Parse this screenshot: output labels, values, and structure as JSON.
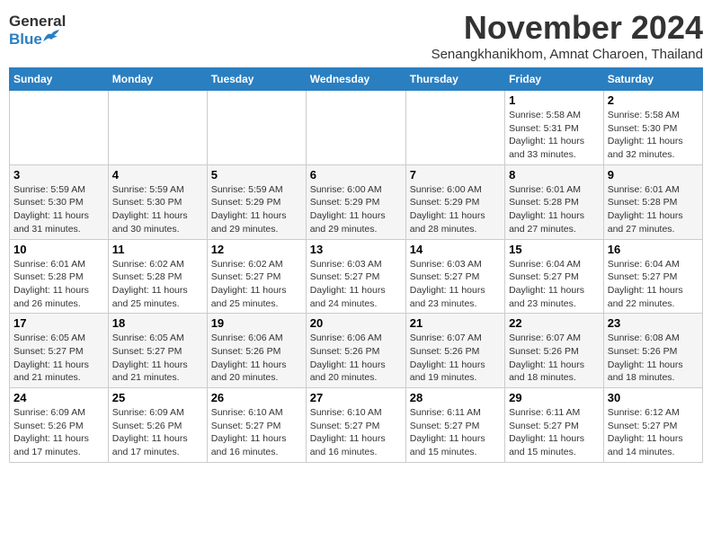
{
  "logo": {
    "line1": "General",
    "line2": "Blue"
  },
  "title": "November 2024",
  "subtitle": "Senangkhanikhom, Amnat Charoen, Thailand",
  "weekdays": [
    "Sunday",
    "Monday",
    "Tuesday",
    "Wednesday",
    "Thursday",
    "Friday",
    "Saturday"
  ],
  "weeks": [
    [
      {
        "day": "",
        "info": ""
      },
      {
        "day": "",
        "info": ""
      },
      {
        "day": "",
        "info": ""
      },
      {
        "day": "",
        "info": ""
      },
      {
        "day": "",
        "info": ""
      },
      {
        "day": "1",
        "info": "Sunrise: 5:58 AM\nSunset: 5:31 PM\nDaylight: 11 hours and 33 minutes."
      },
      {
        "day": "2",
        "info": "Sunrise: 5:58 AM\nSunset: 5:30 PM\nDaylight: 11 hours and 32 minutes."
      }
    ],
    [
      {
        "day": "3",
        "info": "Sunrise: 5:59 AM\nSunset: 5:30 PM\nDaylight: 11 hours and 31 minutes."
      },
      {
        "day": "4",
        "info": "Sunrise: 5:59 AM\nSunset: 5:30 PM\nDaylight: 11 hours and 30 minutes."
      },
      {
        "day": "5",
        "info": "Sunrise: 5:59 AM\nSunset: 5:29 PM\nDaylight: 11 hours and 29 minutes."
      },
      {
        "day": "6",
        "info": "Sunrise: 6:00 AM\nSunset: 5:29 PM\nDaylight: 11 hours and 29 minutes."
      },
      {
        "day": "7",
        "info": "Sunrise: 6:00 AM\nSunset: 5:29 PM\nDaylight: 11 hours and 28 minutes."
      },
      {
        "day": "8",
        "info": "Sunrise: 6:01 AM\nSunset: 5:28 PM\nDaylight: 11 hours and 27 minutes."
      },
      {
        "day": "9",
        "info": "Sunrise: 6:01 AM\nSunset: 5:28 PM\nDaylight: 11 hours and 27 minutes."
      }
    ],
    [
      {
        "day": "10",
        "info": "Sunrise: 6:01 AM\nSunset: 5:28 PM\nDaylight: 11 hours and 26 minutes."
      },
      {
        "day": "11",
        "info": "Sunrise: 6:02 AM\nSunset: 5:28 PM\nDaylight: 11 hours and 25 minutes."
      },
      {
        "day": "12",
        "info": "Sunrise: 6:02 AM\nSunset: 5:27 PM\nDaylight: 11 hours and 25 minutes."
      },
      {
        "day": "13",
        "info": "Sunrise: 6:03 AM\nSunset: 5:27 PM\nDaylight: 11 hours and 24 minutes."
      },
      {
        "day": "14",
        "info": "Sunrise: 6:03 AM\nSunset: 5:27 PM\nDaylight: 11 hours and 23 minutes."
      },
      {
        "day": "15",
        "info": "Sunrise: 6:04 AM\nSunset: 5:27 PM\nDaylight: 11 hours and 23 minutes."
      },
      {
        "day": "16",
        "info": "Sunrise: 6:04 AM\nSunset: 5:27 PM\nDaylight: 11 hours and 22 minutes."
      }
    ],
    [
      {
        "day": "17",
        "info": "Sunrise: 6:05 AM\nSunset: 5:27 PM\nDaylight: 11 hours and 21 minutes."
      },
      {
        "day": "18",
        "info": "Sunrise: 6:05 AM\nSunset: 5:27 PM\nDaylight: 11 hours and 21 minutes."
      },
      {
        "day": "19",
        "info": "Sunrise: 6:06 AM\nSunset: 5:26 PM\nDaylight: 11 hours and 20 minutes."
      },
      {
        "day": "20",
        "info": "Sunrise: 6:06 AM\nSunset: 5:26 PM\nDaylight: 11 hours and 20 minutes."
      },
      {
        "day": "21",
        "info": "Sunrise: 6:07 AM\nSunset: 5:26 PM\nDaylight: 11 hours and 19 minutes."
      },
      {
        "day": "22",
        "info": "Sunrise: 6:07 AM\nSunset: 5:26 PM\nDaylight: 11 hours and 18 minutes."
      },
      {
        "day": "23",
        "info": "Sunrise: 6:08 AM\nSunset: 5:26 PM\nDaylight: 11 hours and 18 minutes."
      }
    ],
    [
      {
        "day": "24",
        "info": "Sunrise: 6:09 AM\nSunset: 5:26 PM\nDaylight: 11 hours and 17 minutes."
      },
      {
        "day": "25",
        "info": "Sunrise: 6:09 AM\nSunset: 5:26 PM\nDaylight: 11 hours and 17 minutes."
      },
      {
        "day": "26",
        "info": "Sunrise: 6:10 AM\nSunset: 5:27 PM\nDaylight: 11 hours and 16 minutes."
      },
      {
        "day": "27",
        "info": "Sunrise: 6:10 AM\nSunset: 5:27 PM\nDaylight: 11 hours and 16 minutes."
      },
      {
        "day": "28",
        "info": "Sunrise: 6:11 AM\nSunset: 5:27 PM\nDaylight: 11 hours and 15 minutes."
      },
      {
        "day": "29",
        "info": "Sunrise: 6:11 AM\nSunset: 5:27 PM\nDaylight: 11 hours and 15 minutes."
      },
      {
        "day": "30",
        "info": "Sunrise: 6:12 AM\nSunset: 5:27 PM\nDaylight: 11 hours and 14 minutes."
      }
    ]
  ]
}
